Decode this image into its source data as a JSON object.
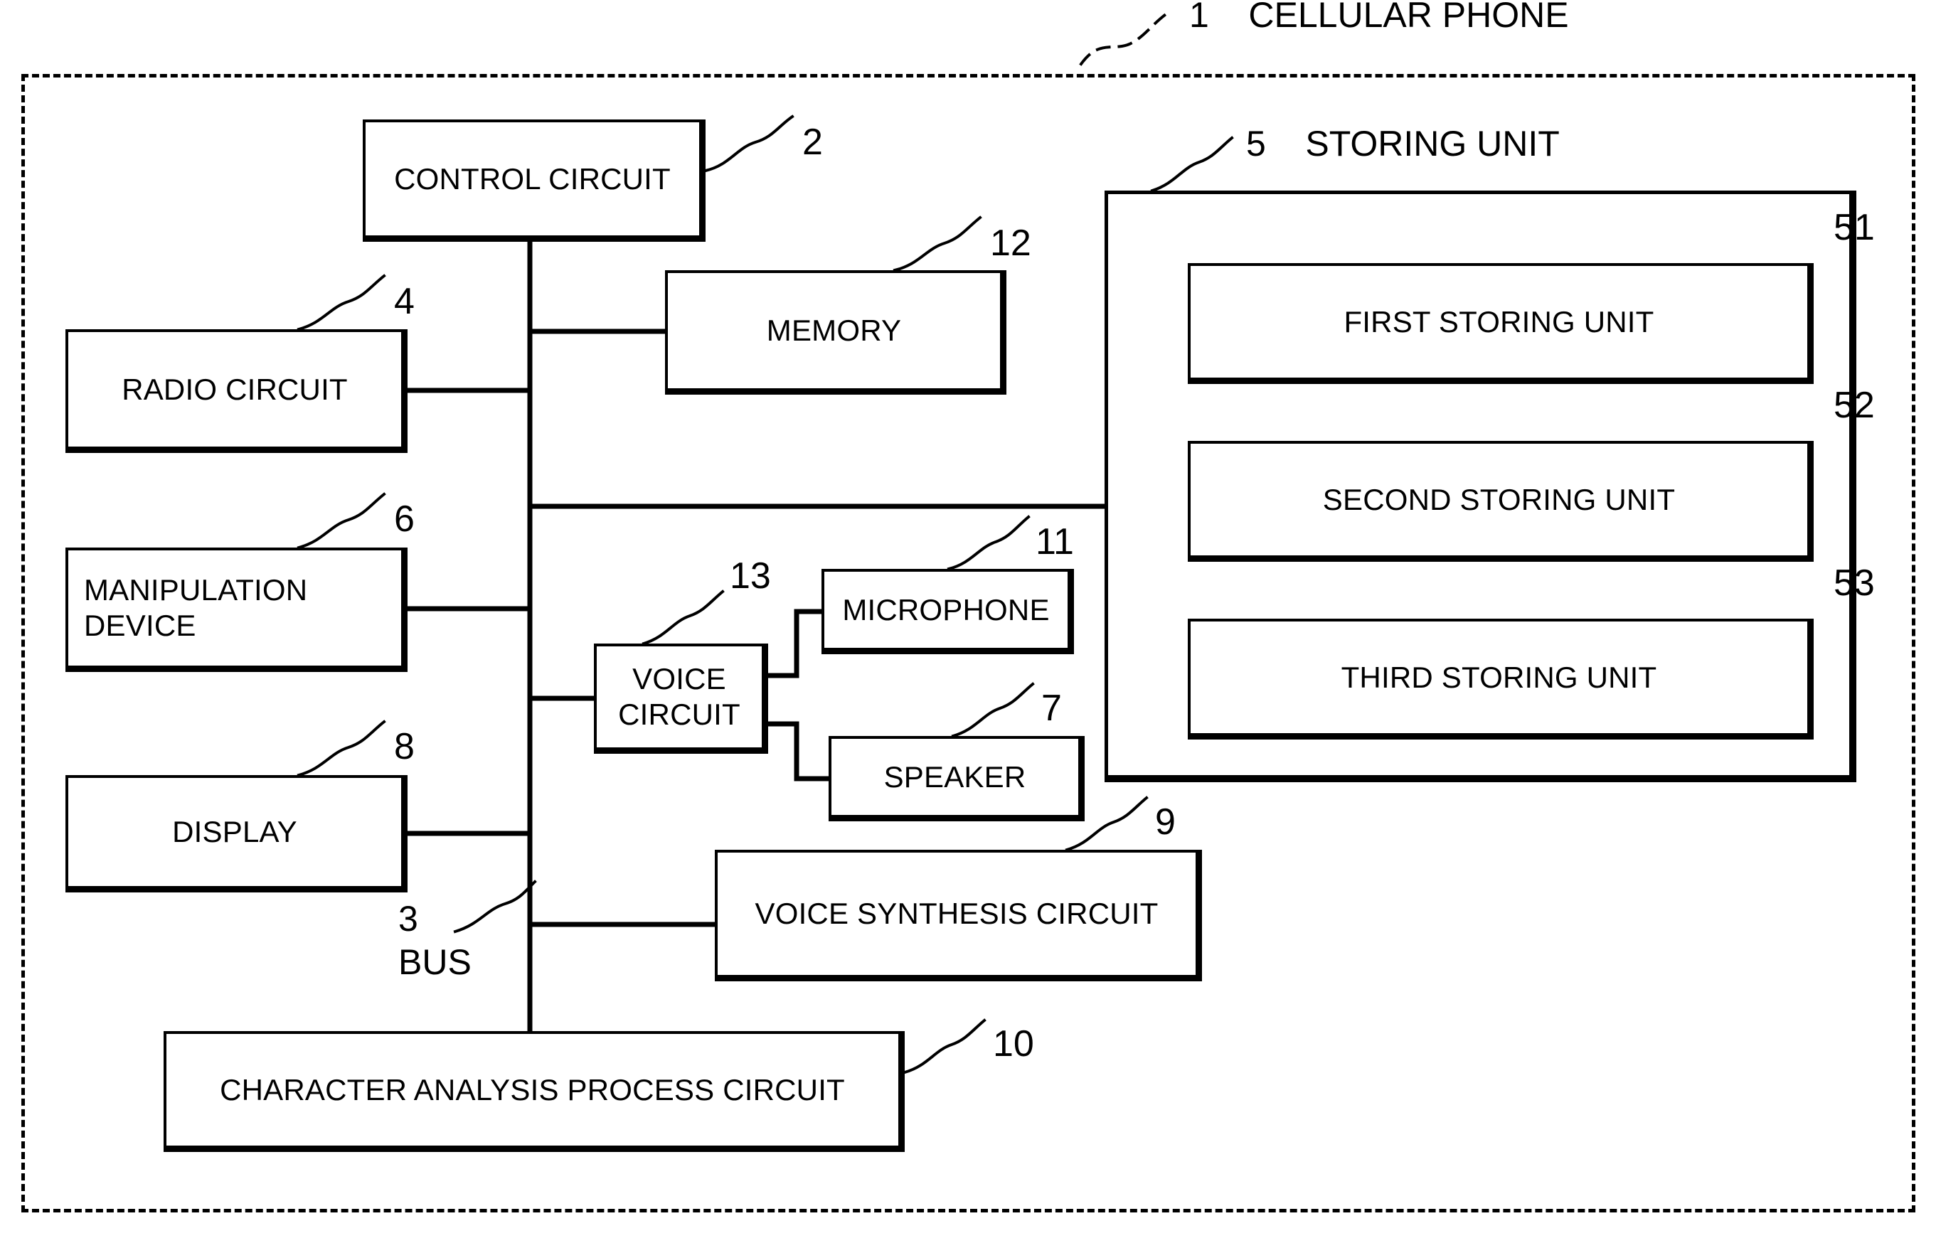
{
  "figure": {
    "title_ref": "1",
    "title_label": "CELLULAR PHONE",
    "storing_unit_ref": "5",
    "storing_unit_label": "STORING UNIT",
    "bus_ref": "3",
    "bus_label": "BUS",
    "line_color": "#000000",
    "background": "#ffffff"
  },
  "blocks": {
    "control_circuit": {
      "label": "CONTROL CIRCUIT",
      "ref": "2"
    },
    "memory": {
      "label": "MEMORY",
      "ref": "12"
    },
    "radio_circuit": {
      "label": "RADIO CIRCUIT",
      "ref": "4"
    },
    "manipulation_device": {
      "label_line1": "MANIPULATION",
      "label_line2": "DEVICE",
      "ref": "6"
    },
    "display": {
      "label": "DISPLAY",
      "ref": "8"
    },
    "voice_circuit": {
      "label_line1": "VOICE",
      "label_line2": "CIRCUIT",
      "ref": "13"
    },
    "microphone": {
      "label": "MICROPHONE",
      "ref": "11"
    },
    "speaker": {
      "label": "SPEAKER",
      "ref": "7"
    },
    "voice_synthesis_circuit": {
      "label": "VOICE SYNTHESIS CIRCUIT",
      "ref": "9"
    },
    "character_analysis_process_circuit": {
      "label": "CHARACTER ANALYSIS PROCESS CIRCUIT",
      "ref": "10"
    },
    "first_storing_unit": {
      "label": "FIRST STORING UNIT",
      "ref": "51"
    },
    "second_storing_unit": {
      "label": "SECOND STORING UNIT",
      "ref": "52"
    },
    "third_storing_unit": {
      "label": "THIRD STORING UNIT",
      "ref": "53"
    }
  }
}
